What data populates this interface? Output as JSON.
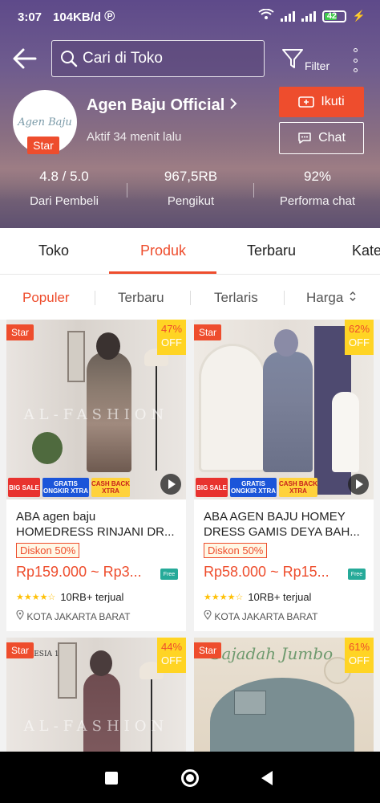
{
  "status_bar": {
    "time": "3:07",
    "speed": "104KB/d",
    "battery": "42"
  },
  "header": {
    "search_placeholder": "Cari di Toko",
    "filter_label": "Filter",
    "logo_text": "Agen Baju",
    "shop_badge": "Star",
    "shop_name": "Agen Baju Official",
    "active_status": "Aktif 34 menit lalu",
    "follow_label": "Ikuti",
    "chat_label": "Chat",
    "stats": [
      {
        "value": "4.8 / 5.0",
        "label": "Dari Pembeli"
      },
      {
        "value": "967,5RB",
        "label": "Pengikut"
      },
      {
        "value": "92%",
        "label": "Performa chat"
      }
    ]
  },
  "tabs": [
    "Toko",
    "Produk",
    "Terbaru",
    "Kate"
  ],
  "active_tab": "Produk",
  "sort": {
    "items": [
      "Populer",
      "Terbaru",
      "Terlaris",
      "Harga"
    ],
    "active": "Populer"
  },
  "products": [
    {
      "badge": "Star",
      "discount_pct": "47%",
      "discount_off": "OFF",
      "watermark": "AL-FASHION",
      "promo": [
        "BIG SALE",
        "GRATIS ONGKIR XTRA",
        "CASH BACK XTRA"
      ],
      "name_line1": "ABA agen baju",
      "name_line2": "HOMEDRESS RINJANI DR...",
      "diskon": "Diskon 50%",
      "price": "Rp159.000 ~ Rp3...",
      "free_label": "Free",
      "sold": "10RB+ terjual",
      "location": "KOTA JAKARTA BARAT",
      "rating": 4.5
    },
    {
      "badge": "Star",
      "discount_pct": "62%",
      "discount_off": "OFF",
      "watermark": "",
      "promo": [
        "BIG SALE",
        "GRATIS ONGKIR XTRA",
        "CASH BACK XTRA"
      ],
      "name_line1": "ABA AGEN BAJU HOMEY",
      "name_line2": "DRESS GAMIS DEYA BAH...",
      "diskon": "Diskon 50%",
      "price": "Rp58.000 ~ Rp15...",
      "free_label": "Free",
      "sold": "10RB+ terjual",
      "location": "KOTA JAKARTA BARAT",
      "rating": 4.5
    },
    {
      "badge": "Star",
      "discount_pct": "44%",
      "discount_off": "OFF",
      "watermark": "AL-FASHION",
      "tag_text": "FLESIA 1"
    },
    {
      "badge": "Star",
      "discount_pct": "61%",
      "discount_off": "OFF",
      "watermark": "Sajadah Jumbo"
    }
  ],
  "colors": {
    "accent": "#ee4d2d",
    "discount_yellow": "#ffd424",
    "freeship": "#26aa99"
  }
}
